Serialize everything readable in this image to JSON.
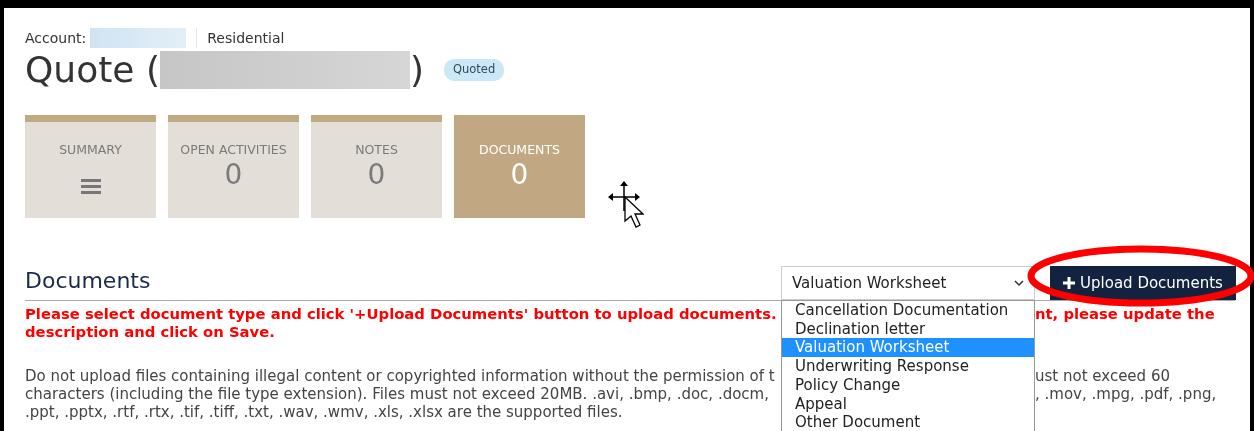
{
  "account": {
    "label": "Account:",
    "type": "Residential"
  },
  "quote": {
    "title_prefix": "Quote (",
    "title_suffix": ")",
    "status": "Quoted"
  },
  "tiles": [
    {
      "label": "SUMMARY",
      "kind": "menu",
      "selected": false
    },
    {
      "label": "OPEN ACTIVITIES",
      "kind": "count",
      "value": "0",
      "selected": false
    },
    {
      "label": "NOTES",
      "kind": "count",
      "value": "0",
      "selected": false
    },
    {
      "label": "DOCUMENTS",
      "kind": "count",
      "value": "0",
      "selected": true
    }
  ],
  "documents": {
    "heading": "Documents",
    "type_select": {
      "value": "Valuation Worksheet",
      "options": [
        {
          "label": "Cancellation Documentation",
          "selected": false
        },
        {
          "label": "Declination letter",
          "selected": false
        },
        {
          "label": "Valuation Worksheet",
          "selected": true
        },
        {
          "label": "Underwriting Response",
          "selected": false
        },
        {
          "label": "Policy Change",
          "selected": false
        },
        {
          "label": "Appeal",
          "selected": false
        },
        {
          "label": "Other Document",
          "selected": false
        }
      ]
    },
    "upload_button": {
      "label": "Upload Documents"
    },
    "instruction_lines": [
      {
        "left": "Please select document type and click '+Upload Documents' button to upload documents.",
        "right": "nt, please update the"
      },
      {
        "left": "description and click on Save."
      }
    ],
    "notice_lines": [
      {
        "left": "Do not upload files containing illegal content or copyrighted information without the permission of t",
        "right": "ust not exceed 60"
      },
      {
        "left": "characters (including the file type extension). Files must not exceed 20MB. .avi, .bmp, .doc, .docm,",
        "right": ", .mov, .mpg, .pdf, .png,"
      },
      {
        "left": ".ppt, .pptx, .rtf, .rtx, .tif, .tiff, .txt, .wav, .wmv, .xls, .xlsx are the supported files."
      }
    ]
  }
}
